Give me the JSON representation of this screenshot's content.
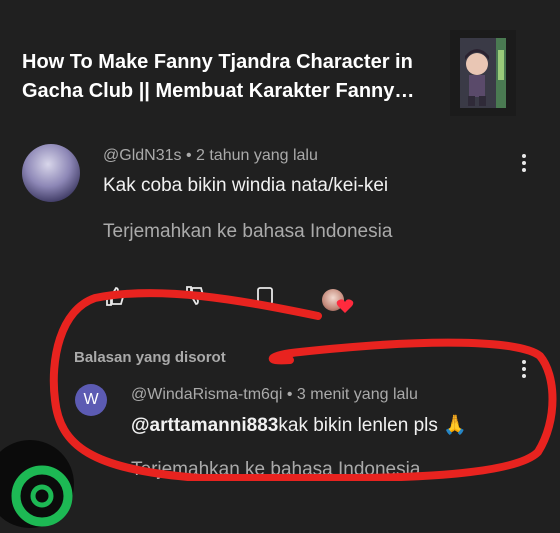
{
  "video": {
    "title": "How To Make Fanny Tjandra Character in Gacha Club || Membuat Karakter Fanny Tjandra di Gacha Club"
  },
  "comment": {
    "author": "@GldN31s",
    "time": "2 tahun yang lalu",
    "text": "Kak coba bikin windia nata/kei-kei",
    "translate": "Terjemahkan ke bahasa Indonesia"
  },
  "highlighted": {
    "label": "Balasan yang disorot"
  },
  "reply": {
    "avatar_letter": "W",
    "author": "@WindaRisma-tm6qi",
    "time": "3 menit yang lalu",
    "mention": "@arttamanni883",
    "text": "kak bikin lenlen pls 🙏",
    "translate": "Terjemahkan ke bahasa Indonesia"
  },
  "colors": {
    "background": "#202020",
    "annotation_red": "#e8231f",
    "reply_avatar": "#5c5bb3",
    "fab_green": "#1db954"
  }
}
